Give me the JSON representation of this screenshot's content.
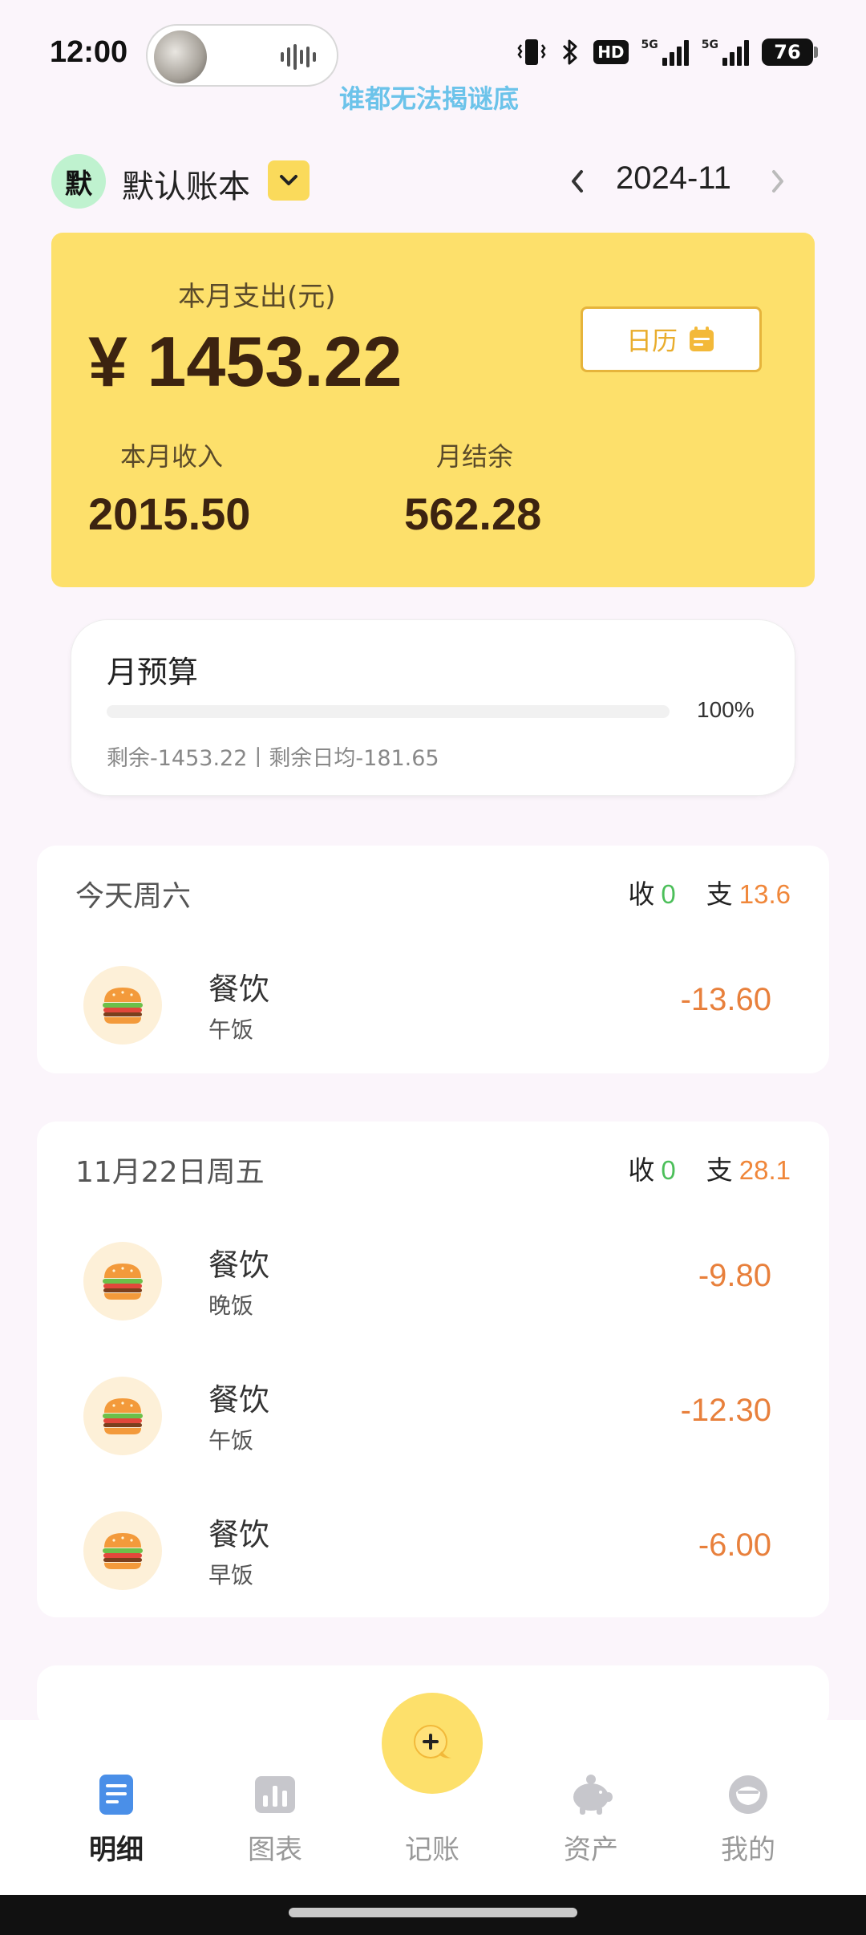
{
  "status_bar": {
    "time": "12:00",
    "network_label_1": "5G",
    "network_label_2": "5G",
    "hd_label": "HD",
    "battery": "76"
  },
  "lyric": "谁都无法揭谜底",
  "header": {
    "book_avatar": "默",
    "book_name": "默认账本",
    "month": "2024-11"
  },
  "summary": {
    "expense_label": "本月支出(元)",
    "expense_amount": "¥ 1453.22",
    "calendar_label": "日历",
    "income_label": "本月收入",
    "income_value": "2015.50",
    "balance_label": "月结余",
    "balance_value": "562.28"
  },
  "budget": {
    "title": "月预算",
    "percent_text": "100%",
    "used_fraction": 0,
    "detail": "剩余-1453.22丨剩余日均-181.65"
  },
  "days": [
    {
      "title": "今天周六",
      "income_label": "收",
      "income": "0",
      "expense_label": "支",
      "expense": "13.6",
      "transactions": [
        {
          "category": "餐饮",
          "note": "午饭",
          "amount": "-13.60",
          "icon": "hamburger-icon"
        }
      ]
    },
    {
      "title": "11月22日周五",
      "income_label": "收",
      "income": "0",
      "expense_label": "支",
      "expense": "28.1",
      "transactions": [
        {
          "category": "餐饮",
          "note": "晚饭",
          "amount": "-9.80",
          "icon": "hamburger-icon"
        },
        {
          "category": "餐饮",
          "note": "午饭",
          "amount": "-12.30",
          "icon": "hamburger-icon"
        },
        {
          "category": "餐饮",
          "note": "早饭",
          "amount": "-6.00",
          "icon": "hamburger-icon"
        }
      ]
    }
  ],
  "nav": {
    "items": [
      {
        "label": "明细",
        "icon": "list-icon",
        "active": true
      },
      {
        "label": "图表",
        "icon": "chart-icon",
        "active": false
      },
      {
        "label": "记账",
        "icon": "add-icon",
        "active": false
      },
      {
        "label": "资产",
        "icon": "piggy-bank-icon",
        "active": false
      },
      {
        "label": "我的",
        "icon": "profile-icon",
        "active": false
      }
    ]
  },
  "colors": {
    "accent_yellow": "#fde06b",
    "expense_orange": "#f0873a",
    "income_green": "#4cbf5a",
    "nav_active_blue": "#4a8fe8"
  }
}
